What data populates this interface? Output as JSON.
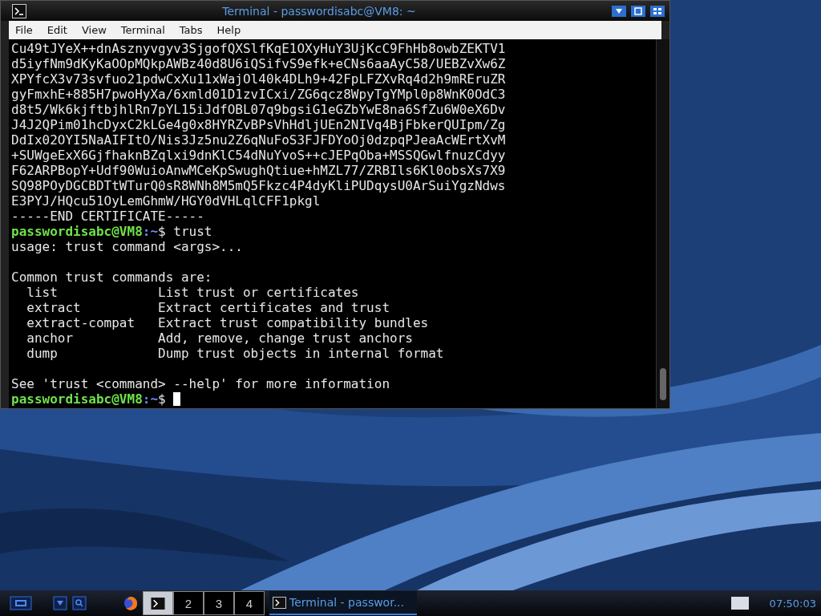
{
  "window": {
    "title": "Terminal - passwordisabc@VM8: ~"
  },
  "menu": [
    "File",
    "Edit",
    "View",
    "Terminal",
    "Tabs",
    "Help"
  ],
  "terminal": {
    "lines": [
      {
        "kind": "text",
        "text": "Cu49tJYeX++dnAsznyvgyv3SjgofQXSlfKqE1OXyHuY3UjKcC9FhHb8owbZEKTV1"
      },
      {
        "kind": "text",
        "text": "d5iyfNm9dKyKaOOpMQkpAWBz40d8U6iQSifvS9efk+eCNs6aaAyC58/UEBZvXw6Z"
      },
      {
        "kind": "text",
        "text": "XPYfcX3v73svfuo21pdwCxXu11xWajOl40k4DLh9+42FpLFZXvRq4d2h9mREruZR"
      },
      {
        "kind": "text",
        "text": "gyFmxhE+885H7pwoHyXa/6xmld01D1zvICxi/ZG6qcz8WpyTgYMpl0p8WnK0OdC3"
      },
      {
        "kind": "text",
        "text": "d8t5/Wk6kjftbjhlRn7pYL15iJdfOBL07q9bgsiG1eGZbYwE8na6SfZu6W0eX6Dv"
      },
      {
        "kind": "text",
        "text": "J4J2QPim01hcDyxC2kLGe4g0x8HYRZvBPsVhHdljUEn2NIVq4BjFbkerQUIpm/Zg"
      },
      {
        "kind": "text",
        "text": "DdIx02OYI5NaAIFItO/Nis3Jz5nu2Z6qNuFoS3FJFDYoOj0dzpqPJeaAcWErtXvM"
      },
      {
        "kind": "text",
        "text": "+SUWgeExX6GjfhaknBZqlxi9dnKlC54dNuYvoS++cJEPqOba+MSSQGwlfnuzCdyy"
      },
      {
        "kind": "text",
        "text": "F62ARPBopY+Udf90WuioAnwMCeKpSwughQtiue+hMZL77/ZRBIls6Kl0obsXs7X9"
      },
      {
        "kind": "text",
        "text": "SQ98POyDGCBDTtWTurQ0sR8WNh8M5mQ5Fkzc4P4dyKliPUDqysU0ArSuiYgzNdws"
      },
      {
        "kind": "text",
        "text": "E3PYJ/HQcu51OyLemGhmW/HGY0dVHLqlCFF1pkgl"
      },
      {
        "kind": "text",
        "text": "-----END CERTIFICATE-----"
      },
      {
        "kind": "prompt",
        "user": "passwordisabc@VM8",
        "path": ":~",
        "symbol": "$",
        "command": "trust"
      },
      {
        "kind": "text",
        "text": "usage: trust command <args>..."
      },
      {
        "kind": "blank"
      },
      {
        "kind": "text",
        "text": "Common trust commands are:"
      },
      {
        "kind": "text",
        "text": "  list             List trust or certificates"
      },
      {
        "kind": "text",
        "text": "  extract          Extract certificates and trust"
      },
      {
        "kind": "text",
        "text": "  extract-compat   Extract trust compatibility bundles"
      },
      {
        "kind": "text",
        "text": "  anchor           Add, remove, change trust anchors"
      },
      {
        "kind": "text",
        "text": "  dump             Dump trust objects in internal format"
      },
      {
        "kind": "blank"
      },
      {
        "kind": "text",
        "text": "See 'trust <command> --help' for more information"
      },
      {
        "kind": "prompt",
        "user": "passwordisabc@VM8",
        "path": ":~",
        "symbol": "$",
        "cursor": true
      }
    ]
  },
  "taskbar": {
    "workspaces": [
      {
        "selected": true
      },
      {
        "label": "2",
        "selected": false
      },
      {
        "label": "3",
        "selected": false
      },
      {
        "label": "4",
        "selected": false
      }
    ],
    "task": {
      "label": "Terminal - passwor...",
      "selected": true
    },
    "clock": "07:50:03"
  }
}
